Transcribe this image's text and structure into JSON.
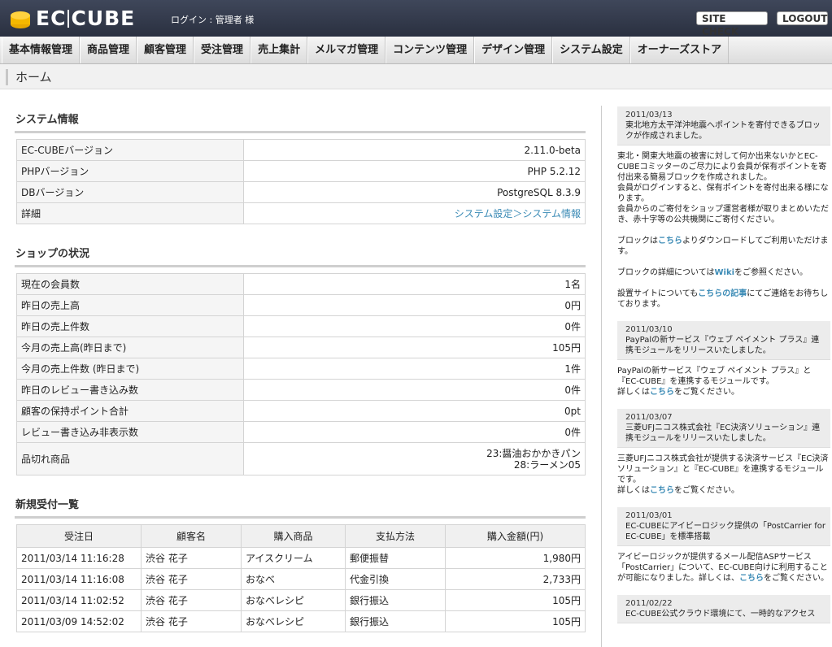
{
  "header": {
    "login_text": "ログイン : 管理者 様",
    "site_check": "SITE CHECK",
    "logout": "LOGOUT"
  },
  "nav": [
    "基本情報管理",
    "商品管理",
    "顧客管理",
    "受注管理",
    "売上集計",
    "メルマガ管理",
    "コンテンツ管理",
    "デザイン管理",
    "システム設定",
    "オーナーズストア"
  ],
  "page_title": "ホーム",
  "system": {
    "heading": "システム情報",
    "rows": [
      {
        "label": "EC-CUBEバージョン",
        "value": "2.11.0-beta"
      },
      {
        "label": "PHPバージョン",
        "value": "PHP 5.2.12"
      },
      {
        "label": "DBバージョン",
        "value": "PostgreSQL 8.3.9"
      }
    ],
    "detail_label": "詳細",
    "detail_link": "システム設定＞システム情報"
  },
  "shop": {
    "heading": "ショップの状況",
    "rows": [
      {
        "label": "現在の会員数",
        "value": "1名"
      },
      {
        "label": "昨日の売上高",
        "value": "0円"
      },
      {
        "label": "昨日の売上件数",
        "value": "0件"
      },
      {
        "label": "今月の売上高(昨日まで)",
        "value": "105円"
      },
      {
        "label": "今月の売上件数 (昨日まで)",
        "value": "1件"
      },
      {
        "label": "昨日のレビュー書き込み数",
        "value": "0件"
      },
      {
        "label": "顧客の保持ポイント合計",
        "value": "0pt"
      },
      {
        "label": "レビュー書き込み非表示数",
        "value": "0件"
      }
    ],
    "soldout_label": "品切れ商品",
    "soldout_1": "23:醤油おかかきパン",
    "soldout_2": "28:ラーメン05"
  },
  "orders": {
    "heading": "新規受付一覧",
    "columns": [
      "受注日",
      "顧客名",
      "購入商品",
      "支払方法",
      "購入金額(円)"
    ],
    "rows": [
      [
        "2011/03/14 11:16:28",
        "渋谷 花子",
        "アイスクリーム",
        "郵便振替",
        "1,980円"
      ],
      [
        "2011/03/14 11:16:08",
        "渋谷 花子",
        "おなべ",
        "代金引換",
        "2,733円"
      ],
      [
        "2011/03/14 11:02:52",
        "渋谷 花子",
        "おなべレシピ",
        "銀行振込",
        "105円"
      ],
      [
        "2011/03/09 14:52:02",
        "渋谷 花子",
        "おなべレシピ",
        "銀行振込",
        "105円"
      ]
    ]
  },
  "news": [
    {
      "date": "2011/03/13",
      "title": "東北地方太平洋沖地震へポイントを寄付できるブロックが作成されました。",
      "p1": "東北・関東大地震の被害に対して何か出来ないかとEC-CUBEコミッターのご尽力により会員が保有ポイントを寄付出来る簡易ブロックを作成されました。\n会員がログインすると、保有ポイントを寄付出来る様になります。\n会員からのご寄付をショップ運営者様が取りまとめいただき、赤十字等の公共機関にご寄付ください。",
      "p2a": "ブロックは",
      "p2link": "こちら",
      "p2b": "よりダウンロードしてご利用いただけます。",
      "p3a": "ブロックの詳細については",
      "p3link": "Wiki",
      "p3b": "をご参照ください。",
      "p4a": "設置サイトについても",
      "p4link": "こちらの記事",
      "p4b": "にてご連絡をお待ちしております。"
    },
    {
      "date": "2011/03/10",
      "title": "PayPalの新サービス『ウェブ ペイメント プラス』連携モジュールをリリースいたしました。",
      "body": "PayPalの新サービス『ウェブ ペイメント プラス』と『EC-CUBE』を連携するモジュールです。",
      "more_a": "詳しくは",
      "more_link": "こちら",
      "more_b": "をご覧ください。"
    },
    {
      "date": "2011/03/07",
      "title": "三菱UFJニコス株式会社『EC決済ソリューション』連携モジュールをリリースいたしました。",
      "body": "三菱UFJニコス株式会社が提供する決済サービス『EC決済ソリューション』と『EC-CUBE』を連携するモジュールです。",
      "more_a": "詳しくは",
      "more_link": "こちら",
      "more_b": "をご覧ください。"
    },
    {
      "date": "2011/03/01",
      "title": "EC-CUBEにアイビーロジック提供の「PostCarrier for EC-CUBE」を標準搭載",
      "body_a": "アイビーロジックが提供するメール配信ASPサービス「PostCarrier」について、EC-CUBE向けに利用することが可能になりました。詳しくは、",
      "body_link": "こちら",
      "body_b": "をご覧ください。"
    },
    {
      "date": "2011/02/22",
      "title": "EC-CUBE公式クラウド環境にて、一時的なアクセス"
    }
  ]
}
